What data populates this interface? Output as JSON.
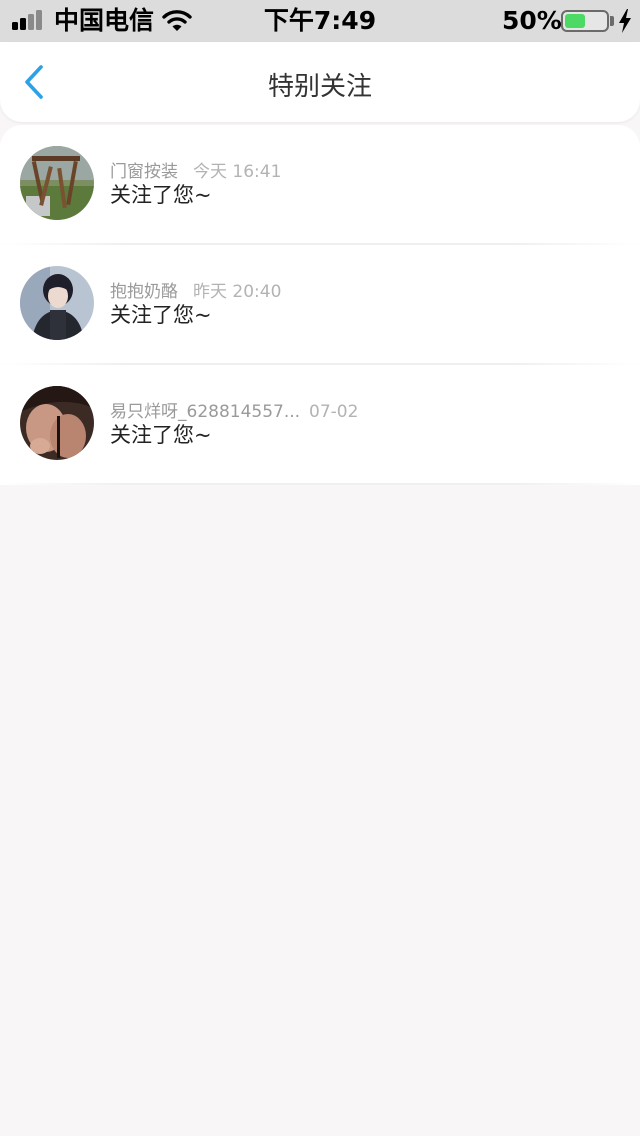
{
  "status_bar": {
    "carrier": "中国电信",
    "time": "下午7:49",
    "battery_percent": "50%",
    "battery_level": 0.5,
    "battery_color": "#4cd964"
  },
  "nav": {
    "title": "特别关注",
    "back_icon": "chevron-left-icon",
    "accent_color": "#2ea1e6"
  },
  "items": [
    {
      "name": "门窗按装",
      "time": "今天 16:41",
      "message": "关注了您~"
    },
    {
      "name": "抱抱奶酪",
      "time": "昨天 20:40",
      "message": "关注了您~"
    },
    {
      "name": "易只烊呀_628814557...",
      "time": "07-02",
      "message": "关注了您~"
    }
  ]
}
